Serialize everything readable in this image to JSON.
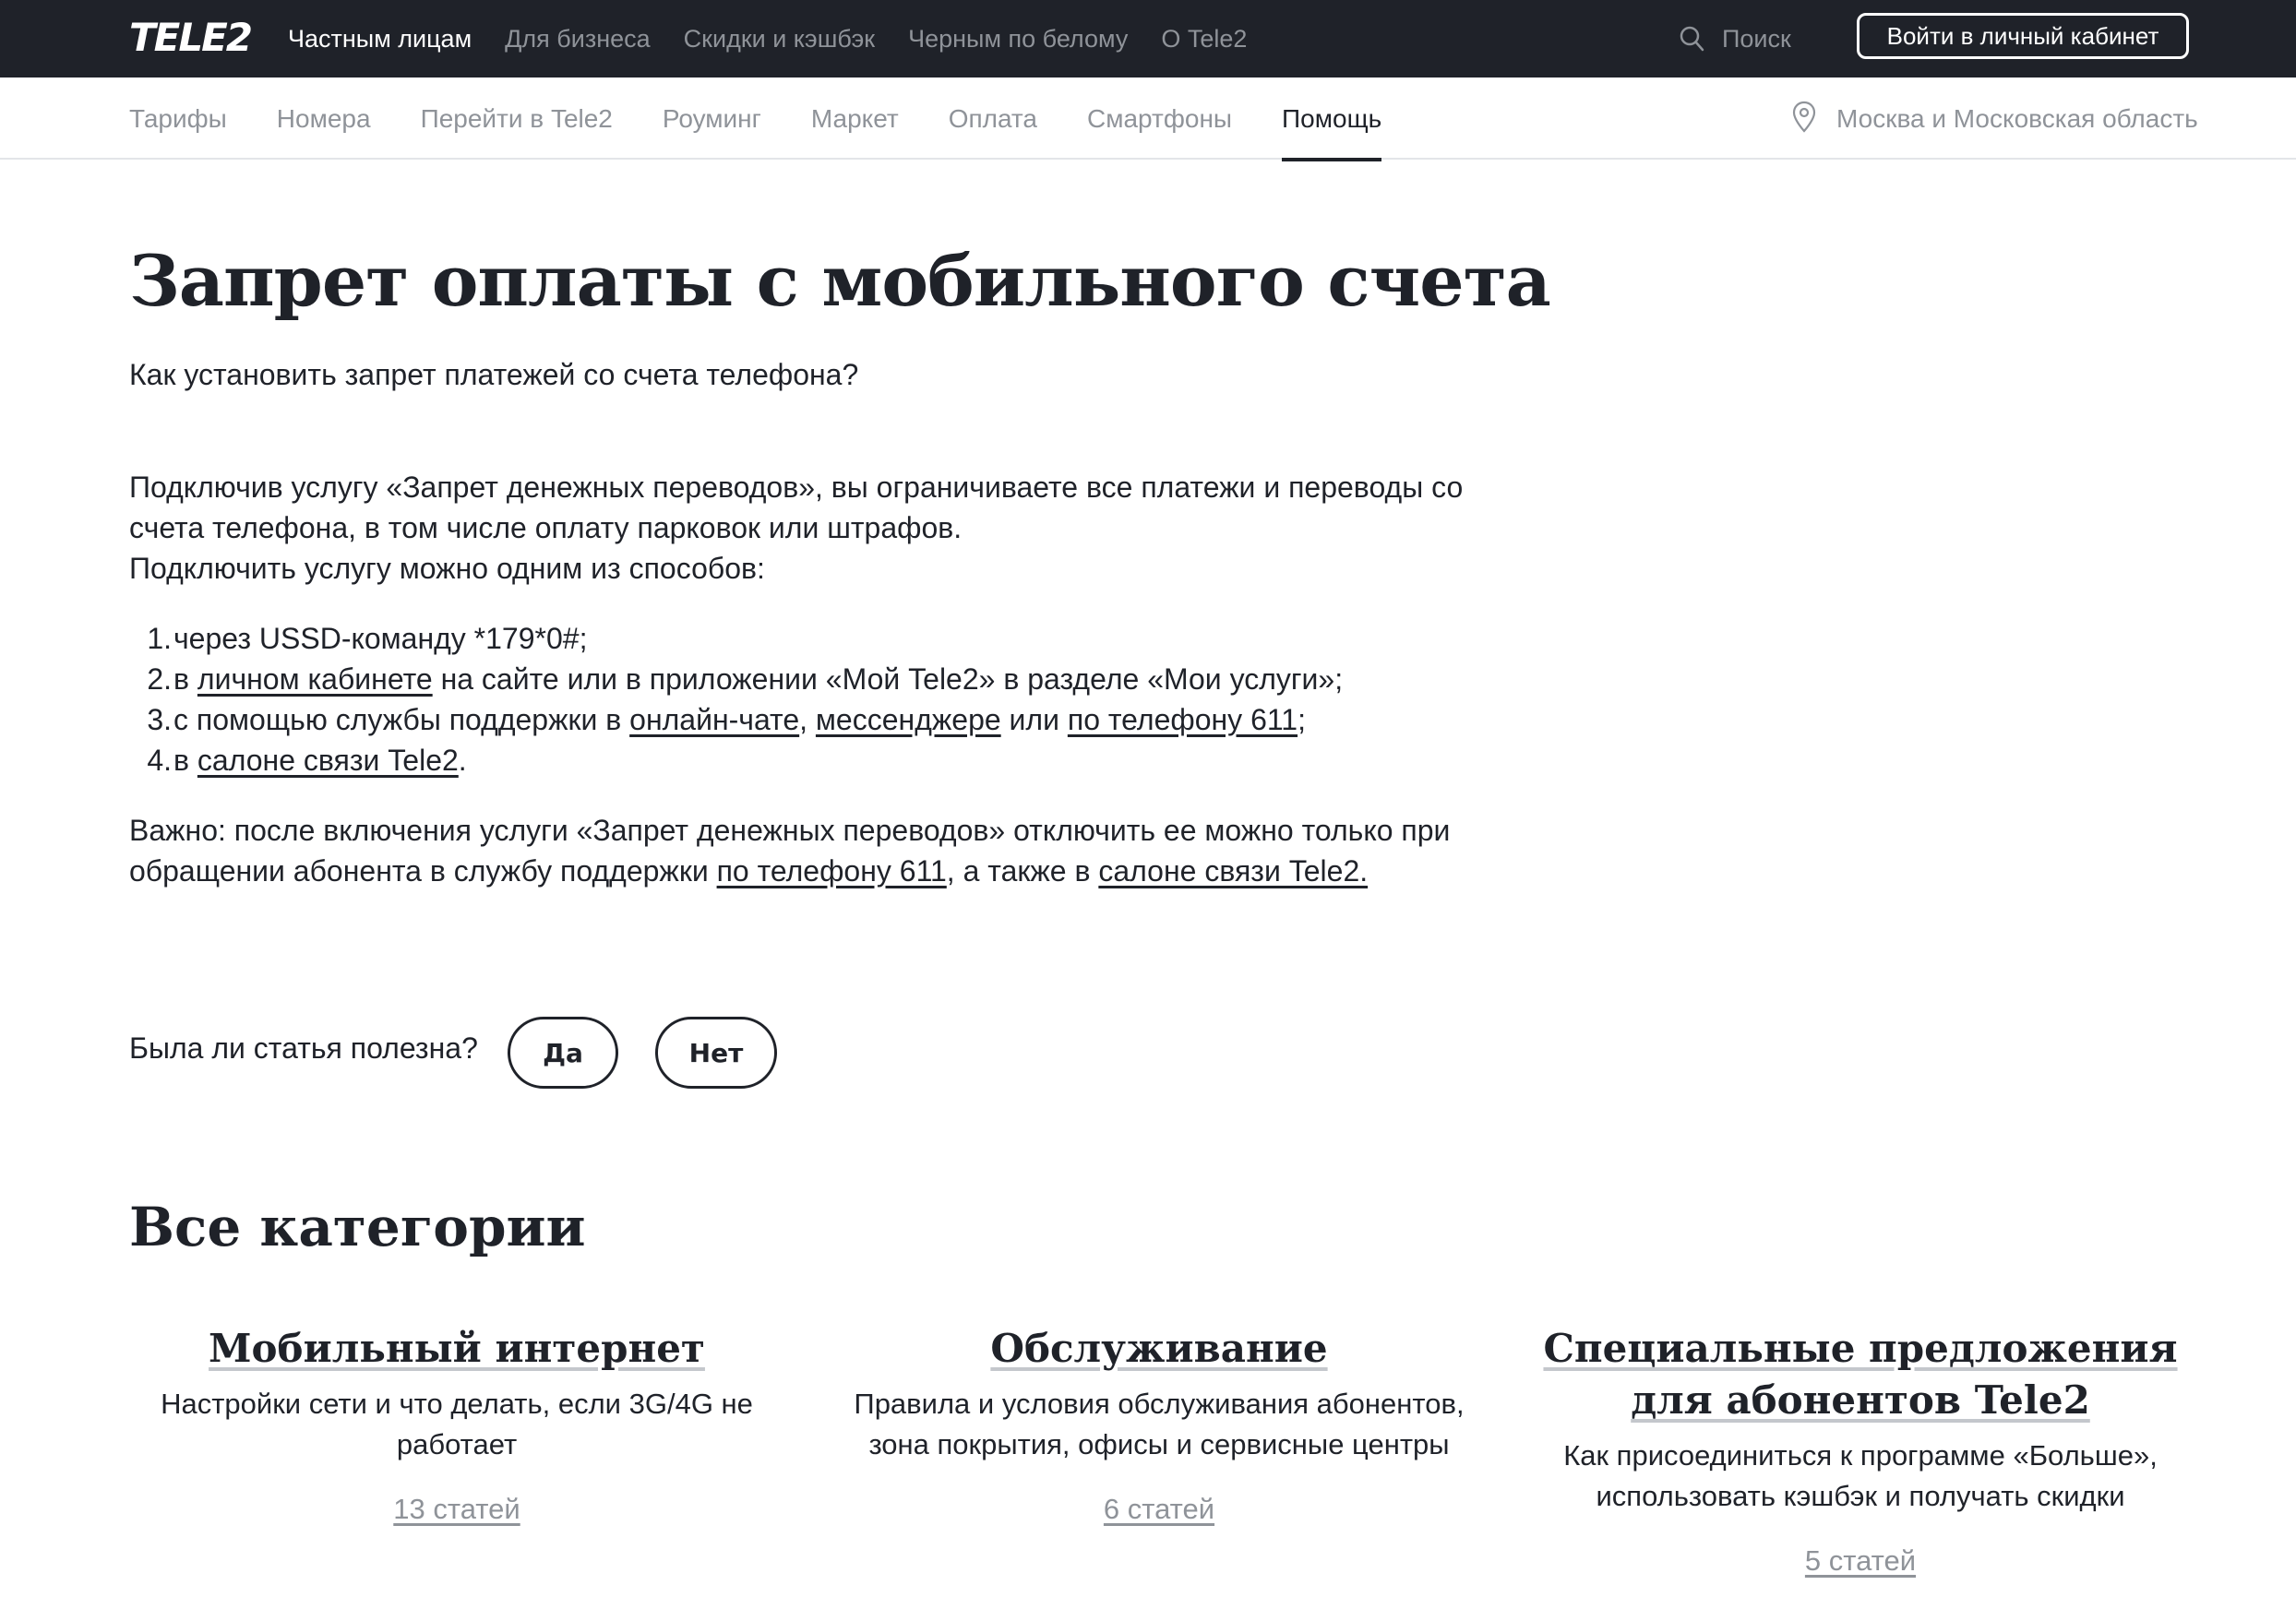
{
  "header": {
    "logo": "TELE2",
    "top_nav": [
      {
        "label": "Частным лицам",
        "active": true
      },
      {
        "label": "Для бизнеса",
        "active": false
      },
      {
        "label": "Скидки и кэшбэк",
        "active": false
      },
      {
        "label": "Черным по белому",
        "active": false
      },
      {
        "label": "О Tele2",
        "active": false
      }
    ],
    "search_label": "Поиск",
    "search_icon": "search-icon",
    "login_button": "Войти в личный кабинет"
  },
  "subnav": {
    "items": [
      {
        "label": "Тарифы",
        "active": false
      },
      {
        "label": "Номера",
        "active": false
      },
      {
        "label": "Перейти в Tele2",
        "active": false
      },
      {
        "label": "Роуминг",
        "active": false
      },
      {
        "label": "Маркет",
        "active": false
      },
      {
        "label": "Оплата",
        "active": false
      },
      {
        "label": "Смартфоны",
        "active": false
      },
      {
        "label": "Помощь",
        "active": true
      }
    ],
    "region": "Москва и Московская область",
    "region_icon": "location-pin-icon"
  },
  "article": {
    "title": "Запрет оплаты с мобильного счета",
    "subtitle": "Как установить запрет платежей со счета телефона?",
    "intro_line1": "Подключив услугу «Запрет денежных переводов», вы ограничиваете все платежи и переводы со счета телефона, в том числе оплату парковок или штрафов.",
    "intro_line2": "Подключить услугу можно одним из способов:",
    "steps": {
      "s1": {
        "num": "1.",
        "text": "через USSD-команду *179*0#;"
      },
      "s2": {
        "num": "2.",
        "pre": "в ",
        "link": "личном кабинете",
        "post": " на сайте или в приложении «Мой Tele2» в разделе «Мои услуги»;"
      },
      "s3": {
        "num": "3.",
        "pre": "с помощью службы поддержки в ",
        "link1": "онлайн-чате",
        "sep": ", ",
        "link2": "мессенджере",
        "mid": " или ",
        "link3": "по телефону 611",
        "post": ";"
      },
      "s4": {
        "num": "4.",
        "pre": "в ",
        "link": "салоне связи Tele2",
        "post": "."
      }
    },
    "important": {
      "pre": "Важно: после включения услуги «Запрет денежных переводов» отключить ее можно только при обращении абонента в службу поддержки ",
      "link1": "по телефону 611",
      "mid": ", а также в ",
      "link2": "салоне связи Tele2."
    }
  },
  "feedback": {
    "question": "Была ли статья полезна?",
    "yes": "Да",
    "no": "Нет"
  },
  "categories": {
    "title": "Все категории",
    "items": [
      {
        "title": "Мобильный интернет",
        "desc": "Настройки сети и что делать, если 3G/4G не работает",
        "count": "13 статей"
      },
      {
        "title": "Обслуживание",
        "desc": "Правила и условия обслуживания абонентов, зона покрытия, офисы и сервисные центры",
        "count": "6 статей"
      },
      {
        "title": "Специальные предложения для абонентов Tele2",
        "desc": "Как присоединиться к программе «Больше», использовать кэшбэк и получать скидки",
        "count": "5 статей"
      }
    ]
  }
}
